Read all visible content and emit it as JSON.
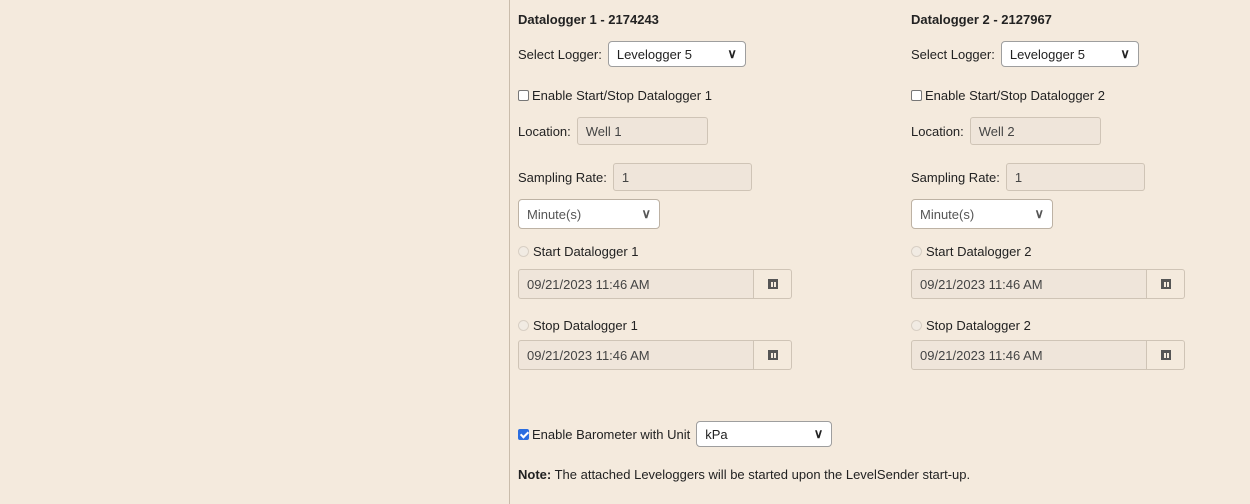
{
  "loggers": [
    {
      "title": "Datalogger 1 - 2174243",
      "select_label": "Select Logger:",
      "select_value": "Levelogger 5",
      "enable_label": "Enable Start/Stop Datalogger 1",
      "location_label": "Location:",
      "location_value": "Well 1",
      "rate_label": "Sampling Rate:",
      "rate_value": "1",
      "unit_value": "Minute(s)",
      "start_label": "Start Datalogger 1",
      "start_value": "09/21/2023 11:46 AM",
      "stop_label": "Stop Datalogger 1",
      "stop_value": "09/21/2023 11:46 AM"
    },
    {
      "title": "Datalogger 2 - 2127967",
      "select_label": "Select Logger:",
      "select_value": "Levelogger 5",
      "enable_label": "Enable Start/Stop Datalogger 2",
      "location_label": "Location:",
      "location_value": "Well 2",
      "rate_label": "Sampling Rate:",
      "rate_value": "1",
      "unit_value": "Minute(s)",
      "start_label": "Start Datalogger 2",
      "start_value": "09/21/2023 11:46 AM",
      "stop_label": "Stop Datalogger 2",
      "stop_value": "09/21/2023 11:46 AM"
    }
  ],
  "barometer": {
    "label": "Enable Barometer with Unit",
    "checked": true,
    "unit_value": "kPa"
  },
  "note": {
    "prefix": "Note:",
    "text": " The attached Leveloggers will be started upon the LevelSender start-up."
  },
  "icons": {
    "dropdown": "chevron-down-icon",
    "calendar": "calendar-icon"
  },
  "colors": {
    "background": "#f4eadd",
    "checkbox_accent": "#2a6de0"
  }
}
